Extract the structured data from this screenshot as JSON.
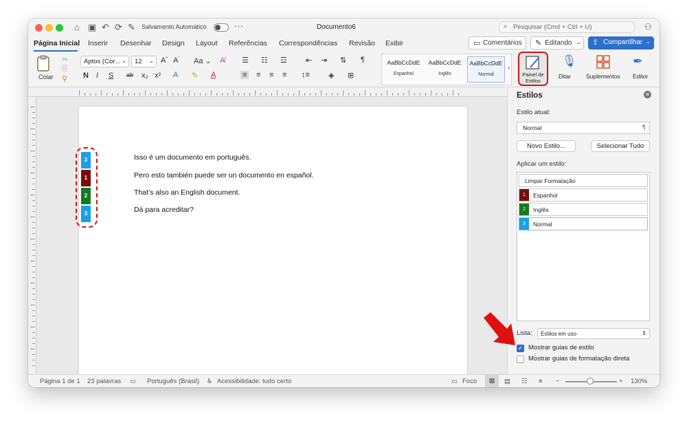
{
  "titlebar": {
    "autosave_label": "Salvamento Automático",
    "doc_title": "Documento6",
    "search_placeholder": "Pesquisar (Cmd + Ctrl + U)"
  },
  "tabs": [
    "Página Inicial",
    "Inserir",
    "Desenhar",
    "Design",
    "Layout",
    "Referências",
    "Correspondências",
    "Revisão",
    "Exibir"
  ],
  "top_buttons": {
    "comments": "Comentários",
    "editing": "Editando",
    "share": "Compartilhar"
  },
  "ribbon": {
    "paste_label": "Colar",
    "font_name": "Aptos (Cor...",
    "font_size": "12",
    "bold": "N",
    "italic": "I",
    "underline": "S",
    "strike": "ab",
    "sub": "x₂",
    "sup": "x²",
    "styles": [
      {
        "sample": "AaBbCcDdE",
        "name": "Espanhol"
      },
      {
        "sample": "AaBbCcDdE",
        "name": "Inglês"
      },
      {
        "sample": "AaBbCcDdE",
        "name": "Normal"
      }
    ],
    "style_pane_label": "Painel de Estilos",
    "dictate_label": "Ditar",
    "addins_label": "Suplementos",
    "editor_label": "Editor"
  },
  "document": {
    "paragraphs": [
      "Isso é um documento em português.",
      "Pero esto también puede ser un documento en español.",
      "That’s also an English document.",
      "Dá para acreditar?"
    ],
    "guides": [
      {
        "num": "3",
        "color": "#1aa0e6"
      },
      {
        "num": "1",
        "color": "#7a0c0c"
      },
      {
        "num": "2",
        "color": "#137a1e"
      },
      {
        "num": "3",
        "color": "#1aa0e6"
      }
    ]
  },
  "pane": {
    "title": "Estilos",
    "current_style_label": "Estilo atual:",
    "current_style": "Normal",
    "new_style_button": "Novo Estilo...",
    "select_all_button": "Selecionar Tudo",
    "apply_label": "Aplicar um estilo:",
    "clear_formatting": "Limpar Formatação",
    "styles": [
      {
        "num": "1",
        "name": "Espanhol",
        "color": "#7a0c0c"
      },
      {
        "num": "2",
        "name": "Inglês",
        "color": "#137a1e"
      },
      {
        "num": "3",
        "name": "Normal",
        "color": "#1aa0e6"
      }
    ],
    "list_label": "Lista:",
    "list_value": "Estilos em uso",
    "show_style_guides": "Mostrar guias de estilo",
    "show_direct_guides": "Mostrar guias de formatação direta"
  },
  "statusbar": {
    "page": "Página 1 de 1",
    "words": "23 palavras",
    "language": "Português (Brasil)",
    "accessibility": "Acessibilidade: tudo certo",
    "focus": "Foco",
    "zoom": "130%"
  },
  "colors": {
    "accent": "#2b6fcf",
    "highlight": "#d01414"
  }
}
